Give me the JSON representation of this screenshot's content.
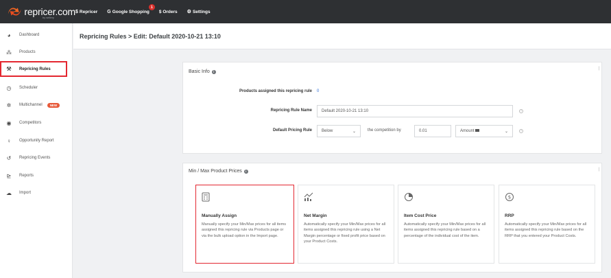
{
  "brand": {
    "name": "repricer.com",
    "sub": "by sellery"
  },
  "topnav": [
    {
      "icon": "$",
      "label": "Repricer"
    },
    {
      "icon": "G",
      "label": "Google Shopping",
      "badge": "1"
    },
    {
      "icon": "",
      "label": "$ Orders"
    },
    {
      "icon": "⚙",
      "label": "Settings"
    }
  ],
  "sidebar": [
    {
      "icon": "◕",
      "label": "Dashboard"
    },
    {
      "icon": "⁂",
      "label": "Products"
    },
    {
      "icon": "⚒",
      "label": "Repricing Rules"
    },
    {
      "icon": "◷",
      "label": "Scheduler"
    },
    {
      "icon": "✲",
      "label": "Multichannel",
      "badge": "NEW"
    },
    {
      "icon": "◉",
      "label": "Competitors"
    },
    {
      "icon": "♀",
      "label": "Opportunity Report"
    },
    {
      "icon": "↺",
      "label": "Repricing Events"
    },
    {
      "icon": "⊵",
      "label": "Reports"
    },
    {
      "icon": "☁",
      "label": "Import"
    }
  ],
  "page": {
    "title": "Repricing Rules > Edit: Default 2020-10-21 13:10"
  },
  "basic_info": {
    "title": "Basic Info",
    "products_assigned_label": "Products assigned this repricing rule",
    "products_assigned_value": "0",
    "rule_name_label": "Repricing Rule Name",
    "rule_name_value": "Default 2020-10-21 13:10",
    "default_rule_label": "Default Pricing Rule",
    "default_rule_select": "Below",
    "competition_text": "the competition by",
    "amount_value": "0.01",
    "amount_type": "Amount"
  },
  "minmax": {
    "title": "Min / Max Product Prices",
    "options": [
      {
        "title": "Manually Assign",
        "desc": "Manually specify your Min/Max prices for all items assigned this repricing rule via Products page or via the bulk upload option in the Import page."
      },
      {
        "title": "Net Margin",
        "desc": "Automatically specify your Min/Max prices for all items assigned this repricing rule using a Net Margin percentage or fixed profit price based on your Product Costs."
      },
      {
        "title": "Item Cost Price",
        "desc": "Automatically specify your Min/Max prices for all items assigned this repricing rule based on a percentage of the individual cost of the item."
      },
      {
        "title": "RRP",
        "desc": "Automatically specify your Min/Max prices for all items assigned this repricing rule based on the RRP that you entered your Product Costs."
      }
    ]
  }
}
